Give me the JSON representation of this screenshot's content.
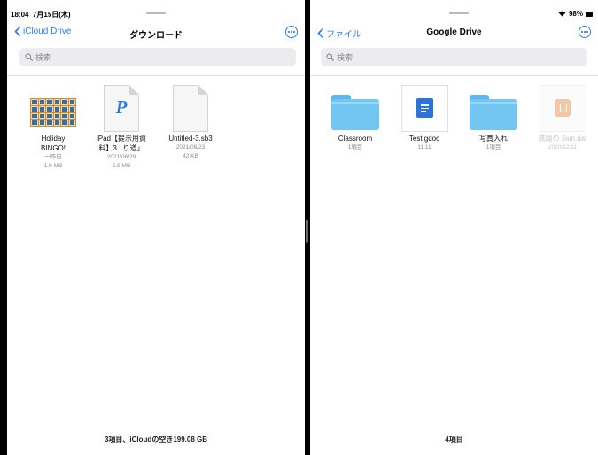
{
  "status_bar": {
    "time": "18:04",
    "date": "7月15日(木)",
    "battery": "98%",
    "icons": [
      "wifi-icon",
      "battery-icon"
    ]
  },
  "left_pane": {
    "back_label": "iCloud Drive",
    "title": "ダウンロード",
    "search_placeholder": "検索",
    "files": [
      {
        "name_line1": "Holiday",
        "name_line2": "BINGO!",
        "meta1": "一昨日",
        "meta2": "1.9 MB",
        "icon": "bingo-card-thumbnail"
      },
      {
        "name_line1": "iPad【提示用資",
        "name_line2": "料】3...り道」",
        "meta1": "2021/06/29",
        "meta2": "5.9 MB",
        "icon": "pages-document-icon"
      },
      {
        "name_line1": "Untitled-3.sb3",
        "name_line2": "",
        "meta1": "2021/06/23",
        "meta2": "42 KB",
        "icon": "blank-document-icon"
      }
    ],
    "footer": "3項目、iCloudの空き199.08 GB"
  },
  "right_pane": {
    "back_label": "ファイル",
    "title": "Google Drive",
    "search_placeholder": "検索",
    "files": [
      {
        "name": "Classroom",
        "meta": "1項目",
        "icon": "folder-icon"
      },
      {
        "name": "Test.gdoc",
        "meta": "11:11",
        "icon": "google-docs-icon"
      },
      {
        "name": "写真入れ",
        "meta": "1項目",
        "icon": "folder-icon"
      },
      {
        "name": "無題の Jam.dat",
        "meta": "2020/12/11",
        "icon": "jamboard-icon"
      }
    ],
    "footer": "4項目"
  },
  "colors": {
    "accent": "#2f7bf6",
    "folder": "#74c6f2",
    "search_bg": "#ececf0",
    "divider": "#000000"
  }
}
